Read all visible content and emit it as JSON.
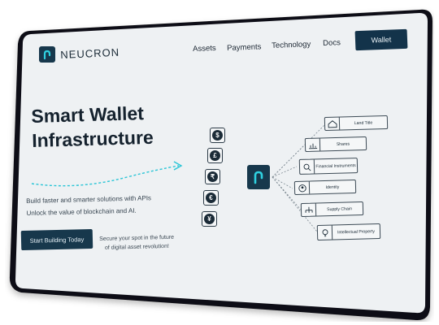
{
  "header": {
    "brand": "NEUCRON",
    "nav": [
      "Assets",
      "Payments",
      "Technology",
      "Docs"
    ],
    "wallet_button": "Wallet"
  },
  "hero": {
    "title_line1": "Smart Wallet",
    "title_line2": "Infrastructure",
    "subtitle_line1": "Build faster and smarter solutions with APIs",
    "subtitle_line2": "Unlock the value of blockchain and AI.",
    "cta": "Start Building Today",
    "secure_line1": "Secure your spot in the future",
    "secure_line2": "of digital asset revolution!"
  },
  "currencies": [
    "$",
    "£",
    "₹",
    "€",
    "¥"
  ],
  "tags": [
    {
      "label": "Land Title",
      "icon": "house-icon"
    },
    {
      "label": "Shares",
      "icon": "chart-icon"
    },
    {
      "label": "Financial Instruments",
      "icon": "magnifier-icon"
    },
    {
      "label": "Identity",
      "icon": "person-icon"
    },
    {
      "label": "Supply Chain",
      "icon": "network-icon"
    },
    {
      "label": "Intellectual Property",
      "icon": "bulb-icon"
    }
  ],
  "colors": {
    "accent": "#17384c",
    "teal": "#29c5d6",
    "screen": "#eef1f3",
    "bezel": "#0f1012"
  }
}
